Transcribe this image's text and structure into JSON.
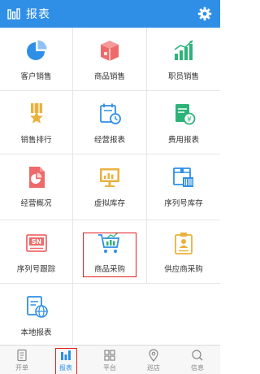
{
  "header": {
    "title": "报表"
  },
  "grid": {
    "items": [
      {
        "label": "客户销售",
        "icon": "pie-chart-icon"
      },
      {
        "label": "商品销售",
        "icon": "box-icon"
      },
      {
        "label": "职员销售",
        "icon": "bar-growth-icon"
      },
      {
        "label": "销售排行",
        "icon": "medal-star-icon"
      },
      {
        "label": "经营报表",
        "icon": "calendar-clock-icon"
      },
      {
        "label": "费用报表",
        "icon": "money-doc-icon"
      },
      {
        "label": "经营概况",
        "icon": "pie-doc-icon"
      },
      {
        "label": "虚拟库存",
        "icon": "monitor-chart-icon"
      },
      {
        "label": "序列号库存",
        "icon": "package-barcode-icon"
      },
      {
        "label": "序列号跟踪",
        "icon": "sn-tag-icon"
      },
      {
        "label": "商品采购",
        "icon": "shopping-cart-icon"
      },
      {
        "label": "供应商采购",
        "icon": "supplier-badge-icon"
      },
      {
        "label": "本地报表",
        "icon": "globe-doc-icon"
      }
    ]
  },
  "tabbar": {
    "tabs": [
      {
        "label": "开单",
        "icon": "document-icon"
      },
      {
        "label": "报表",
        "icon": "report-bars-icon",
        "active": true
      },
      {
        "label": "平台",
        "icon": "grid-icon"
      },
      {
        "label": "巡店",
        "icon": "location-pin-icon"
      },
      {
        "label": "信息",
        "icon": "chat-search-icon"
      }
    ]
  },
  "colors": {
    "brand": "#2f8fe6",
    "highlight": "#e32020"
  }
}
